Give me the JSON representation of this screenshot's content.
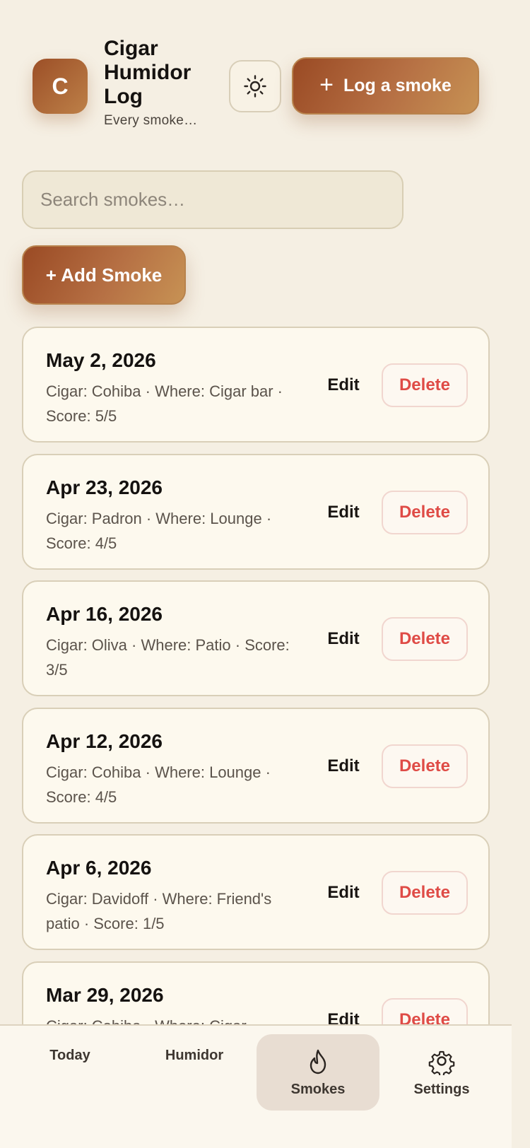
{
  "header": {
    "logo_letter": "C",
    "title": "Cigar Humidor Log",
    "subtitle": "Every smoke…",
    "theme_icon": "sun-icon",
    "log_button_label": "Log a smoke"
  },
  "search": {
    "placeholder": "Search smokes…",
    "value": ""
  },
  "add_button_label": "+ Add Smoke",
  "smokes": [
    {
      "date": "May 2, 2026",
      "meta": "Cigar: Cohiba · Where: Cigar bar · Score: 5/5",
      "edit_label": "Edit",
      "delete_label": "Delete"
    },
    {
      "date": "Apr 23, 2026",
      "meta": "Cigar: Padron · Where: Lounge · Score: 4/5",
      "edit_label": "Edit",
      "delete_label": "Delete"
    },
    {
      "date": "Apr 16, 2026",
      "meta": "Cigar: Oliva · Where: Patio · Score: 3/5",
      "edit_label": "Edit",
      "delete_label": "Delete"
    },
    {
      "date": "Apr 12, 2026",
      "meta": "Cigar: Cohiba · Where: Lounge · Score: 4/5",
      "edit_label": "Edit",
      "delete_label": "Delete"
    },
    {
      "date": "Apr 6, 2026",
      "meta": "Cigar: Davidoff · Where: Friend's patio · Score: 1/5",
      "edit_label": "Edit",
      "delete_label": "Delete"
    },
    {
      "date": "Mar 29, 2026",
      "meta": "Cigar: Cohiba · Where: Cigar",
      "edit_label": "Edit",
      "delete_label": "Delete"
    }
  ],
  "nav": {
    "items": [
      {
        "label": "Today",
        "icon": ""
      },
      {
        "label": "Humidor",
        "icon": ""
      },
      {
        "label": "Smokes",
        "icon": "flame-icon",
        "active": true
      },
      {
        "label": "Settings",
        "icon": "gear-icon"
      }
    ]
  },
  "colors": {
    "background": "#f5efe3",
    "accent_start": "#9a4a24",
    "accent_end": "#c79254",
    "delete": "#df4b46"
  }
}
